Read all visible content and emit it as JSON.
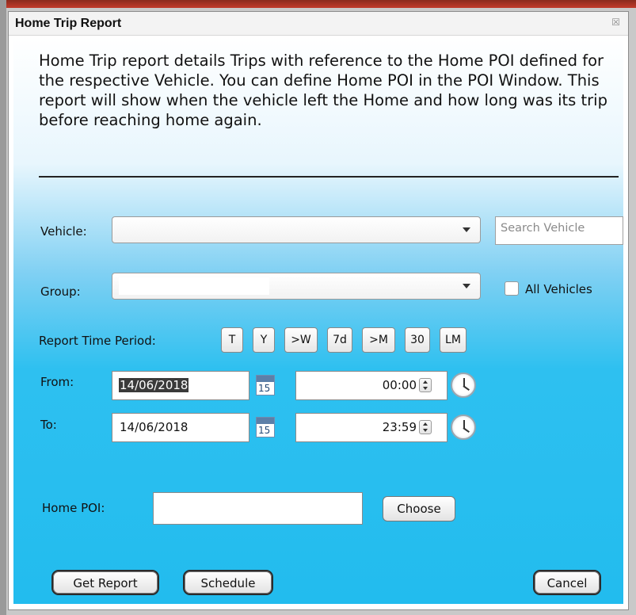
{
  "dialog": {
    "title": "Home Trip Report",
    "close_glyph": "☒"
  },
  "description": "Home Trip report details Trips with reference to the Home POI defined for the respective Vehicle. You can define Home POI in the POI Window. This report will show when the vehicle left the Home and how long was its trip before reaching home again.",
  "vehicle": {
    "label": "Vehicle:",
    "value": "",
    "search_placeholder": "Search Vehicle"
  },
  "group": {
    "label": "Group:",
    "value": "",
    "all_vehicles_label": "All Vehicles",
    "all_vehicles_checked": false
  },
  "report_time_period": {
    "label": "Report Time Period:",
    "buttons": [
      "T",
      "Y",
      ">W",
      "7d",
      ">M",
      "30",
      "LM"
    ]
  },
  "from": {
    "label": "From:",
    "date": "14/06/2018",
    "calendar_day": "15",
    "time": "00:00"
  },
  "to": {
    "label": "To:",
    "date": "14/06/2018",
    "calendar_day": "15",
    "time": "23:59"
  },
  "home_poi": {
    "label": "Home POI:",
    "value": "",
    "choose_label": "Choose"
  },
  "footer": {
    "get_report_label": "Get Report",
    "schedule_label": "Schedule",
    "cancel_label": "Cancel"
  },
  "icons": {
    "calendar": "calendar-icon",
    "clock": "clock-icon",
    "dropdown": "chevron-down-icon",
    "close": "close-icon"
  }
}
